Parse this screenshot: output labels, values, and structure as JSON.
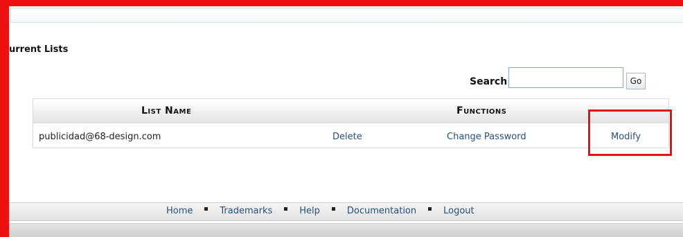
{
  "section": {
    "title": "urrent Lists"
  },
  "search": {
    "label": "Search",
    "value": "",
    "go_label": "Go"
  },
  "table": {
    "headers": {
      "list_name": "List Name",
      "functions": "Functions"
    },
    "rows": [
      {
        "name": "publicidad@68-design.com",
        "delete": "Delete",
        "change_password": "Change Password",
        "modify": "Modify"
      }
    ]
  },
  "footer": {
    "links": [
      "Home",
      "Trademarks",
      "Help",
      "Documentation",
      "Logout"
    ]
  },
  "colors": {
    "annotation_red": "#ee1111",
    "link_blue": "#244f7e"
  }
}
